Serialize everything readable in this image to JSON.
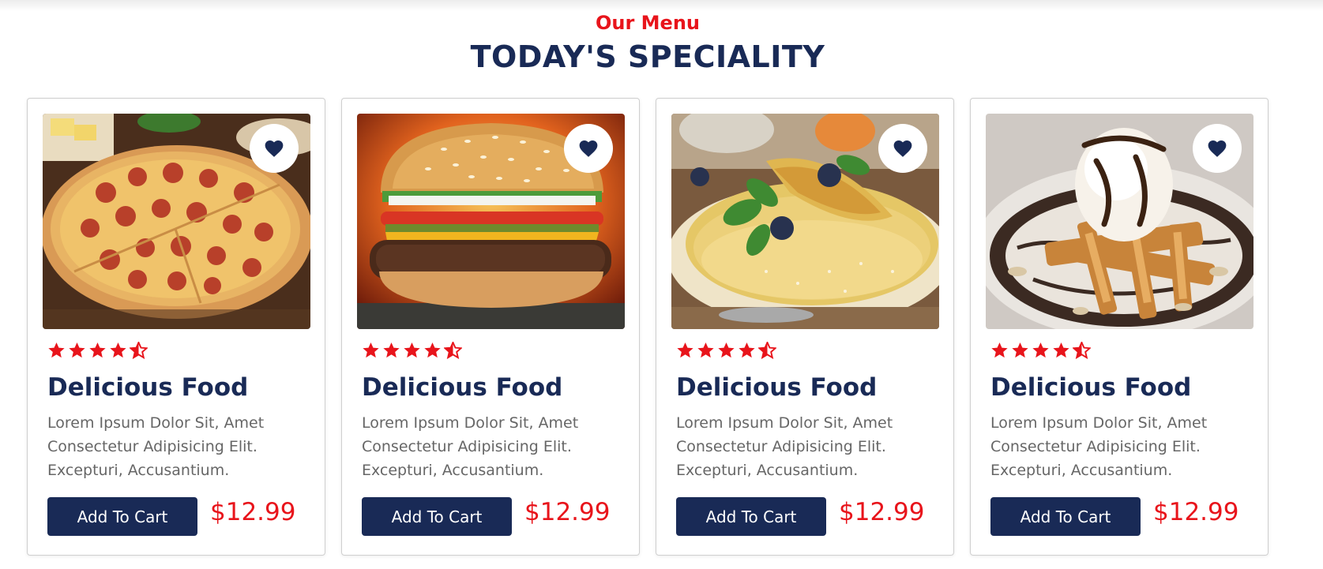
{
  "section": {
    "subheading": "Our Menu",
    "heading": "TODAY'S SPECIALITY"
  },
  "colors": {
    "accent_red": "#e8141b",
    "navy": "#192a56",
    "text_gray": "#666666"
  },
  "cards": [
    {
      "image": "pepperoni-pizza",
      "rating": 4.5,
      "title": "Delicious Food",
      "description": "Lorem Ipsum Dolor Sit, Amet Consectetur Adipisicing Elit. Excepturi, Accusantium.",
      "button_label": "Add To Cart",
      "price": "$12.99"
    },
    {
      "image": "cheeseburger",
      "rating": 4.5,
      "title": "Delicious Food",
      "description": "Lorem Ipsum Dolor Sit, Amet Consectetur Adipisicing Elit. Excepturi, Accusantium.",
      "button_label": "Add To Cart",
      "price": "$12.99"
    },
    {
      "image": "crepes-with-blueberries",
      "rating": 4.5,
      "title": "Delicious Food",
      "description": "Lorem Ipsum Dolor Sit, Amet Consectetur Adipisicing Elit. Excepturi, Accusantium.",
      "button_label": "Add To Cart",
      "price": "$12.99"
    },
    {
      "image": "waffles-with-ice-cream",
      "rating": 4.5,
      "title": "Delicious Food",
      "description": "Lorem Ipsum Dolor Sit, Amet Consectetur Adipisicing Elit. Excepturi, Accusantium.",
      "button_label": "Add To Cart",
      "price": "$12.99"
    }
  ],
  "icons": {
    "favorite": "heart-icon",
    "rating": "star-icon"
  }
}
